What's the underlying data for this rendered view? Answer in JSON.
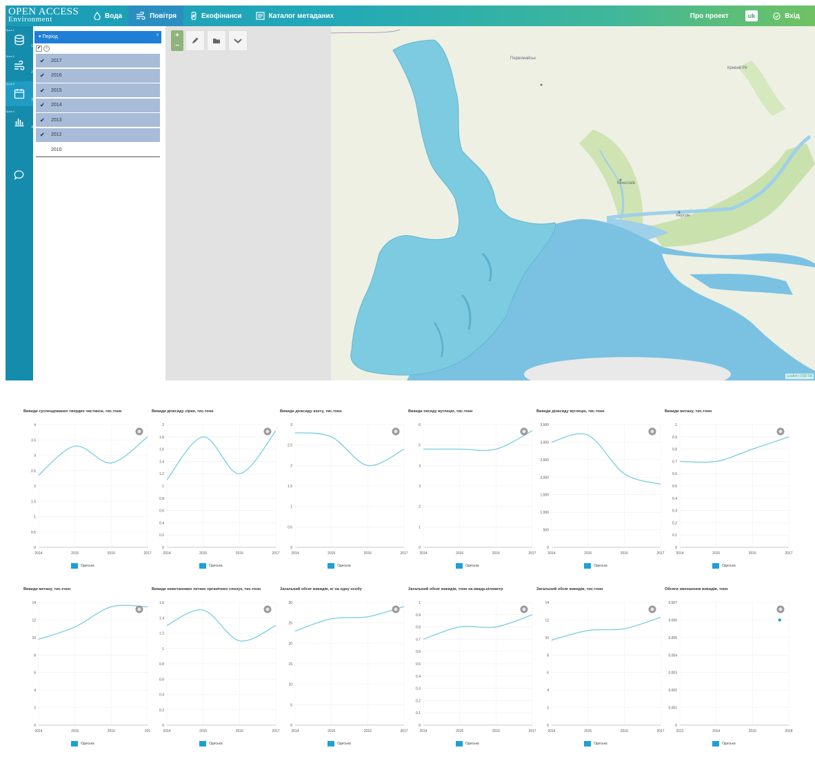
{
  "brand": {
    "line1": "OPEN ACCESS",
    "line2": "Environment"
  },
  "nav": {
    "items": [
      {
        "label": "Вода",
        "icon": "water-drop-icon",
        "active": false
      },
      {
        "label": "Повітря",
        "icon": "wind-icon",
        "active": true
      },
      {
        "label": "Екофінанси",
        "icon": "hryvnia-icon",
        "active": false
      },
      {
        "label": "Каталог метаданих",
        "icon": "catalog-icon",
        "active": false
      }
    ],
    "about": "Про проект",
    "language": "uk",
    "login": "Вхід"
  },
  "rail": {
    "steps": [
      {
        "label": "Крок 1",
        "num": "1",
        "icon": "database-icon"
      },
      {
        "label": "Крок 2",
        "num": "2",
        "icon": "wind-icon"
      },
      {
        "label": "Крок 3",
        "num": "3",
        "icon": "calendar-icon",
        "active": true
      },
      {
        "label": "Крок 4",
        "num": "4",
        "icon": "bar-chart-icon"
      }
    ],
    "chat_icon": "chat-icon"
  },
  "panel": {
    "header": "Період",
    "close": "x",
    "years": [
      {
        "label": "2017",
        "checked": true
      },
      {
        "label": "2016",
        "checked": true
      },
      {
        "label": "2015",
        "checked": true
      },
      {
        "label": "2014",
        "checked": true
      },
      {
        "label": "2013",
        "checked": true
      },
      {
        "label": "2012",
        "checked": true
      },
      {
        "label": "2010",
        "checked": false
      }
    ]
  },
  "map": {
    "labels": {
      "l1": "Первомайськ",
      "l2": "Кривий Ріг",
      "l3": "Миколаїв",
      "l4": "Херсон"
    },
    "attribution": "Leaflet | OSFTM"
  },
  "colors": {
    "line": "#7fcfe6",
    "legend": "#1ea0d4",
    "region": "#7ccbe0",
    "sea": "#7bc2e2"
  },
  "legend_label": "Одеська",
  "chart_data": [
    {
      "type": "line",
      "title": "Викиди суспендованих твердих частинок, тис.тонн",
      "x": [
        2014,
        2015,
        2016,
        2017
      ],
      "ylim": [
        0,
        4
      ],
      "yticks": [
        "0",
        "0.5",
        "1",
        "1.5",
        "2",
        "2.5",
        "3",
        "3.5",
        "4"
      ],
      "series": [
        {
          "name": "Одеська",
          "values": [
            2.35,
            3.3,
            2.75,
            3.6
          ]
        }
      ]
    },
    {
      "type": "line",
      "title": "Викиди діоксиду сірки, тис.тонн",
      "x": [
        2014,
        2015,
        2016,
        2017
      ],
      "ylim": [
        0,
        2
      ],
      "yticks": [
        "0",
        "0.2",
        "0.4",
        "0.6",
        "0.8",
        "1",
        "1.2",
        "1.4",
        "1.6",
        "1.8",
        "2"
      ],
      "series": [
        {
          "name": "Одеська",
          "values": [
            1.1,
            1.8,
            1.2,
            1.9
          ]
        }
      ]
    },
    {
      "type": "line",
      "title": "Викиди діоксиду азоту, тис.тонн",
      "x": [
        2014,
        2015,
        2016,
        2017
      ],
      "ylim": [
        0,
        3
      ],
      "yticks": [
        "0",
        "0.5",
        "1",
        "1.5",
        "2",
        "2.5",
        "3"
      ],
      "series": [
        {
          "name": "Одеська",
          "values": [
            2.8,
            2.7,
            2.0,
            2.4
          ]
        }
      ]
    },
    {
      "type": "line",
      "title": "Викиди оксиду вуглецю, тис.тонн",
      "x": [
        2014,
        2015,
        2016,
        2017
      ],
      "ylim": [
        0,
        6
      ],
      "yticks": [
        "0",
        "1",
        "2",
        "3",
        "4",
        "5",
        "6"
      ],
      "series": [
        {
          "name": "Одеська",
          "values": [
            4.8,
            4.8,
            4.8,
            5.7
          ]
        }
      ]
    },
    {
      "type": "line",
      "title": "Викиди діоксиду вуглецю, тис.тонн",
      "x": [
        2014,
        2015,
        2016,
        2017
      ],
      "ylim": [
        0,
        3500
      ],
      "yticks": [
        "0",
        "500",
        "1,000",
        "1,500",
        "2,000",
        "2,500",
        "3,000",
        "3,500"
      ],
      "series": [
        {
          "name": "Одеська",
          "values": [
            3000,
            3200,
            2100,
            1800
          ]
        }
      ]
    },
    {
      "type": "line",
      "title": "Викиди метану, тис.тонн",
      "x": [
        2014,
        2015,
        2016,
        2017
      ],
      "ylim": [
        0,
        1
      ],
      "yticks": [
        "0",
        "0.1",
        "0.2",
        "0.3",
        "0.4",
        "0.5",
        "0.6",
        "0.7",
        "0.8",
        "0.9",
        "1"
      ],
      "series": [
        {
          "name": "Одеська",
          "values": [
            0.7,
            0.7,
            0.8,
            0.9
          ]
        }
      ]
    },
    {
      "type": "line",
      "title": "Викиди метану, тис.тонн",
      "x": [
        2014,
        2015,
        2016,
        2017
      ],
      "ylim": [
        0,
        14
      ],
      "yticks": [
        "0",
        "2",
        "4",
        "6",
        "8",
        "10",
        "12",
        "14"
      ],
      "xticks_override": [
        "2014",
        "2015",
        "2016",
        "201"
      ],
      "series": [
        {
          "name": "Одеська",
          "values": [
            9.8,
            11.2,
            13.5,
            13.5
          ]
        }
      ]
    },
    {
      "type": "line",
      "title": "Викиди неметанових летких органічних сполук, тис.тонн",
      "x": [
        2014,
        2015,
        2016,
        2017
      ],
      "ylim": [
        0,
        1.6
      ],
      "yticks": [
        "0",
        "0.2",
        "0.4",
        "0.6",
        "0.8",
        "1",
        "1.2",
        "1.4",
        "1.6"
      ],
      "series": [
        {
          "name": "Одеська",
          "values": [
            1.3,
            1.5,
            1.1,
            1.3
          ]
        }
      ]
    },
    {
      "type": "line",
      "title": "Загальний обсяг викидів, кг на одну особу",
      "x": [
        2014,
        2015,
        2016,
        2017
      ],
      "ylim": [
        0,
        30
      ],
      "yticks": [
        "0",
        "5",
        "10",
        "15",
        "20",
        "25",
        "30"
      ],
      "series": [
        {
          "name": "Одеська",
          "values": [
            23,
            26,
            26.5,
            29
          ]
        }
      ]
    },
    {
      "type": "line",
      "title": "Загальний обсяг викидів, тонн на квадр.кілометр",
      "x": [
        2014,
        2015,
        2016,
        2017
      ],
      "ylim": [
        0,
        1
      ],
      "yticks": [
        "0",
        "0.1",
        "0.2",
        "0.3",
        "0.4",
        "0.5",
        "0.6",
        "0.7",
        "0.8",
        "0.9",
        "1"
      ],
      "series": [
        {
          "name": "Одеська",
          "values": [
            0.7,
            0.8,
            0.8,
            0.9
          ]
        }
      ]
    },
    {
      "type": "line",
      "title": "Загальний обсяг викидів, тис.тонн",
      "x": [
        2014,
        2015,
        2016,
        2017
      ],
      "ylim": [
        0,
        14
      ],
      "yticks": [
        "0",
        "2",
        "4",
        "6",
        "8",
        "10",
        "12",
        "14"
      ],
      "series": [
        {
          "name": "Одеська",
          "values": [
            9.7,
            10.8,
            11.0,
            12.3
          ]
        }
      ]
    },
    {
      "type": "scatter",
      "title": "Обсяги зменшення викидів, тонн",
      "x_ticks": [
        "2012",
        "2014",
        "2016",
        "2018"
      ],
      "xlim": [
        2012,
        2018
      ],
      "ylim": [
        0,
        0.007
      ],
      "yticks": [
        "0",
        "0.001",
        "0.002",
        "0.003",
        "0.004",
        "0.005",
        "0.006",
        "0.007"
      ],
      "series": [
        {
          "name": "Одеська",
          "points": [
            [
              2017.5,
              0.006
            ]
          ]
        }
      ]
    }
  ]
}
